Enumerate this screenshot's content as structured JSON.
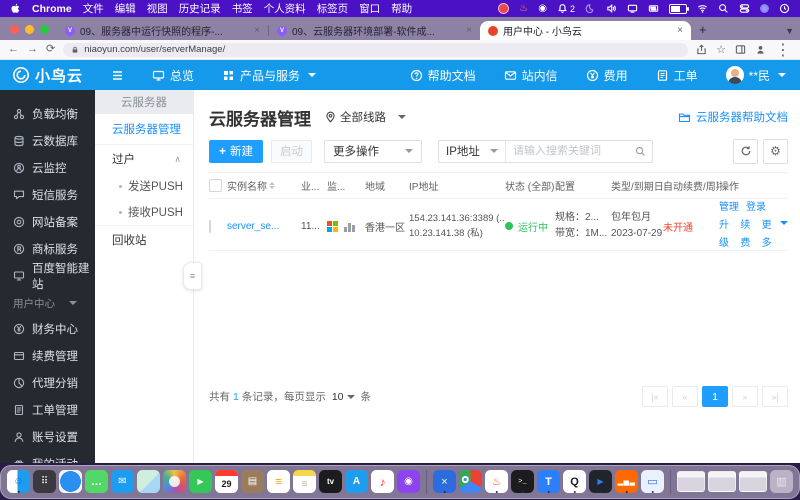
{
  "menubar": {
    "app_name": "Chrome",
    "menus": [
      "文件",
      "编辑",
      "视图",
      "历史记录",
      "书签",
      "个人资料",
      "标签页",
      "窗口",
      "帮助"
    ],
    "bell_count": "2"
  },
  "browser": {
    "tabs": [
      {
        "title": "09、服务器中运行快照的程序-..."
      },
      {
        "title": "09、云服务器环境部署-软件成..."
      },
      {
        "title": "用户中心 - 小鸟云"
      }
    ],
    "url": "niaoyun.com/user/serverManage/"
  },
  "topnav": {
    "brand": "小鸟云",
    "overview": "总览",
    "products": "产品与服务",
    "help": "帮助文档",
    "inbox": "站内信",
    "billing": "费用",
    "ticket": "工单",
    "username": "**民"
  },
  "sidebar": {
    "items": [
      "负载均衡",
      "云数据库",
      "云监控",
      "短信服务",
      "网站备案",
      "商标服务",
      "百度智能建站"
    ],
    "section": "用户中心",
    "user_items": [
      "财务中心",
      "续费管理",
      "代理分销",
      "工单管理",
      "账号设置",
      "我的活动"
    ]
  },
  "subsidebar": {
    "header": "云服务器",
    "active_item": "云服务器管理",
    "group_label": "过户",
    "group_items": [
      "发送PUSH",
      "接收PUSH"
    ],
    "recycle": "回收站"
  },
  "main": {
    "title": "云服务器管理",
    "line_filter": "全部线路",
    "help_doc": "云服务器帮助文档",
    "toolbar": {
      "create": "新建",
      "start": "启动",
      "more_ops": "更多操作",
      "ip_filter": "IP地址",
      "search_placeholder": "请输入搜索关键词"
    },
    "table": {
      "headers": [
        "实例名称",
        "业...",
        "监...",
        "地域",
        "IP地址",
        "状态 (全部)",
        "配置",
        "类型/到期日...",
        "自动续费/周期",
        "操作"
      ],
      "row": {
        "name": "server_se...",
        "business": "11...",
        "region": "香港一区",
        "ip_public": "154.23.141.36:3389 (...",
        "ip_private": "10.23.141.38 (私)",
        "status": "运行中",
        "spec": "规格：2...",
        "bandwidth": "带宽：1M...",
        "billing_type": "包年包月",
        "expire_date": "2023-07-29...",
        "auto_renew": "未开通",
        "actions": [
          "管理",
          "登录",
          "升级",
          "续费",
          "更多"
        ]
      }
    },
    "pagination": {
      "prefix": "共有",
      "total": "1",
      "middle": "条记录，每页显示",
      "page_size": "10",
      "suffix": "条",
      "page": "1",
      "first": "|«",
      "prev": "«",
      "next": "»",
      "last": "»|"
    }
  },
  "dock": {
    "apps": [
      {
        "name": "finder",
        "glyph": "☺"
      },
      {
        "name": "launchpad",
        "glyph": "⠿"
      },
      {
        "name": "safari",
        "glyph": ""
      },
      {
        "name": "messages",
        "glyph": "…"
      },
      {
        "name": "mail",
        "glyph": "✉"
      },
      {
        "name": "maps",
        "glyph": ""
      },
      {
        "name": "photos",
        "glyph": ""
      },
      {
        "name": "facetime",
        "glyph": "▶"
      },
      {
        "name": "calendar",
        "glyph": "29"
      },
      {
        "name": "contacts",
        "glyph": "▤"
      },
      {
        "name": "reminders",
        "glyph": "≡"
      },
      {
        "name": "notes",
        "glyph": "≡"
      },
      {
        "name": "apple-tv",
        "glyph": "tv"
      },
      {
        "name": "app-store",
        "glyph": "A"
      },
      {
        "name": "music",
        "glyph": "♪"
      },
      {
        "name": "podcasts",
        "glyph": "◉"
      },
      {
        "name": "blue-x-app",
        "glyph": "×"
      },
      {
        "name": "chrome",
        "glyph": ""
      },
      {
        "name": "orange-app",
        "glyph": "♨"
      },
      {
        "name": "terminal",
        "glyph": ">_"
      },
      {
        "name": "blue-t-app",
        "glyph": "T"
      },
      {
        "name": "qq",
        "glyph": "Q"
      },
      {
        "name": "ev-app",
        "glyph": "▶"
      },
      {
        "name": "stats-app",
        "glyph": "▂▅▃"
      },
      {
        "name": "display-app",
        "glyph": "▭"
      },
      {
        "name": "trash",
        "glyph": "▥"
      }
    ]
  }
}
